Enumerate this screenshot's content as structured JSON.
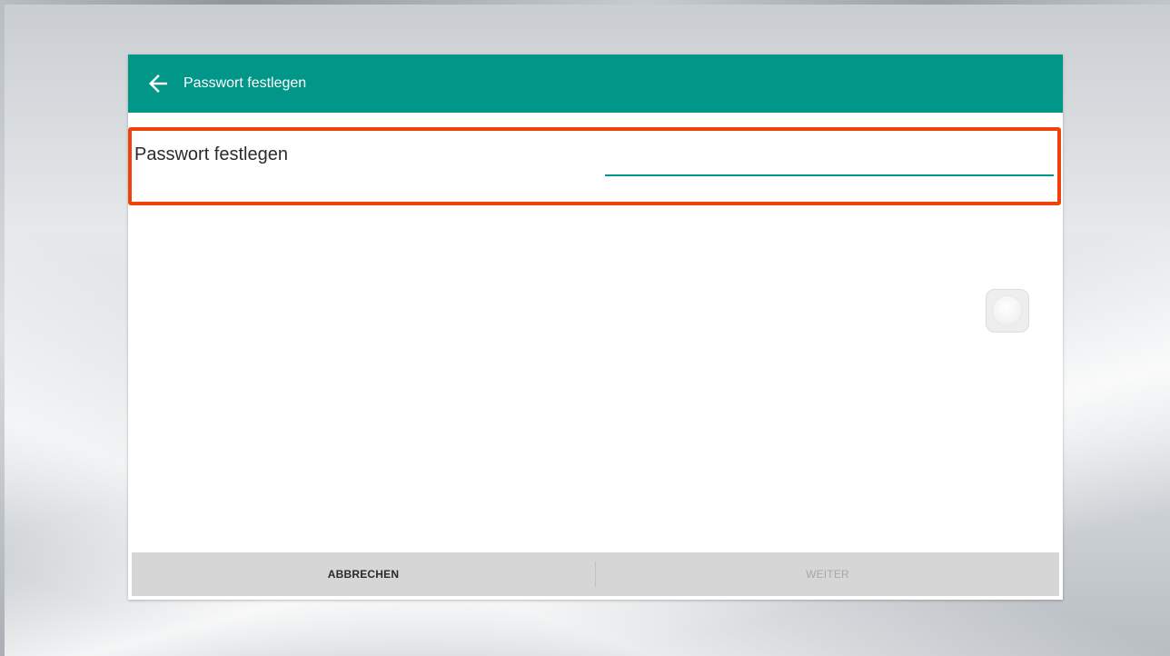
{
  "appbar": {
    "back_icon": "arrow-left-icon",
    "title": "Passwort festlegen"
  },
  "password_field": {
    "label": "Passwort festlegen",
    "value": "",
    "placeholder": ""
  },
  "toggle": {
    "icon": "toggle-knob-icon"
  },
  "buttons": {
    "cancel_label": "ABBRECHEN",
    "next_label": "WEITER"
  },
  "colors": {
    "appbar": "#009688",
    "highlight": "#f0420b",
    "input_underline": "#009688",
    "button_bar": "#d6d6d6",
    "disabled_text": "#a8a8a8"
  }
}
